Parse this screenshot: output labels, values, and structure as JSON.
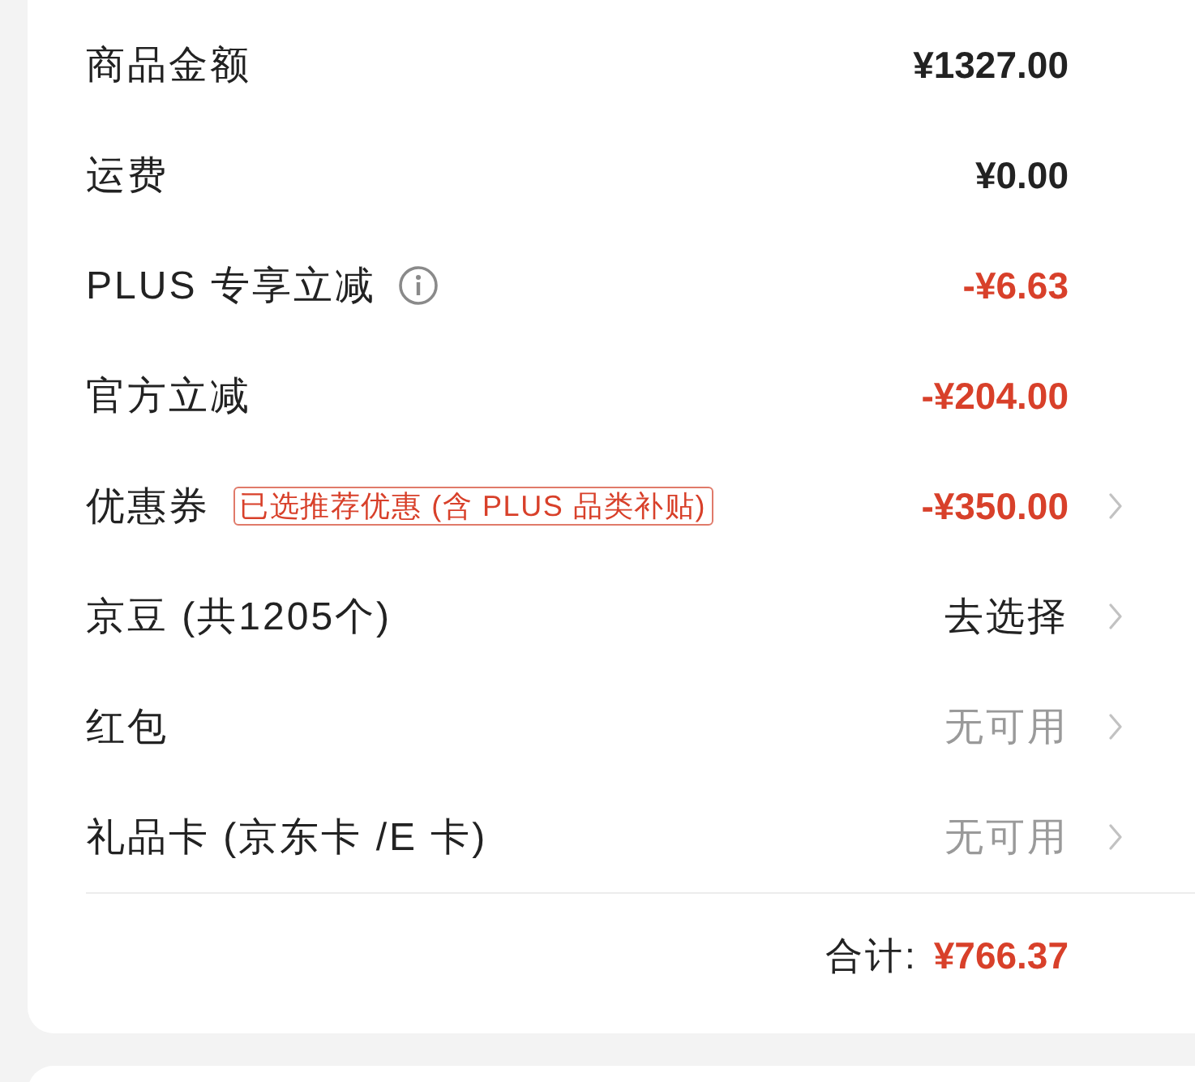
{
  "rows": [
    {
      "label": "商品金额",
      "value": "¥1327.00",
      "kind": "amount",
      "chevron": false
    },
    {
      "label": "运费",
      "value": "¥0.00",
      "kind": "amount",
      "chevron": false
    },
    {
      "label": "PLUS 专享立减",
      "info": true,
      "value": "-¥6.63",
      "kind": "discount",
      "chevron": false
    },
    {
      "label": "官方立减",
      "value": "-¥204.00",
      "kind": "discount",
      "chevron": false
    },
    {
      "label": "优惠券",
      "tag": "已选推荐优惠 (含 PLUS 品类补贴)",
      "value": "-¥350.00",
      "kind": "discount",
      "chevron": true
    },
    {
      "label": "京豆 (共1205个)",
      "value": "去选择",
      "kind": "action",
      "chevron": true
    },
    {
      "label": "红包",
      "value": "无可用",
      "kind": "unavailable",
      "chevron": true
    },
    {
      "label": "礼品卡 (京东卡 /E 卡)",
      "value": "无可用",
      "kind": "unavailable",
      "chevron": true
    }
  ],
  "total": {
    "label": "合计:",
    "value": "¥766.37"
  }
}
